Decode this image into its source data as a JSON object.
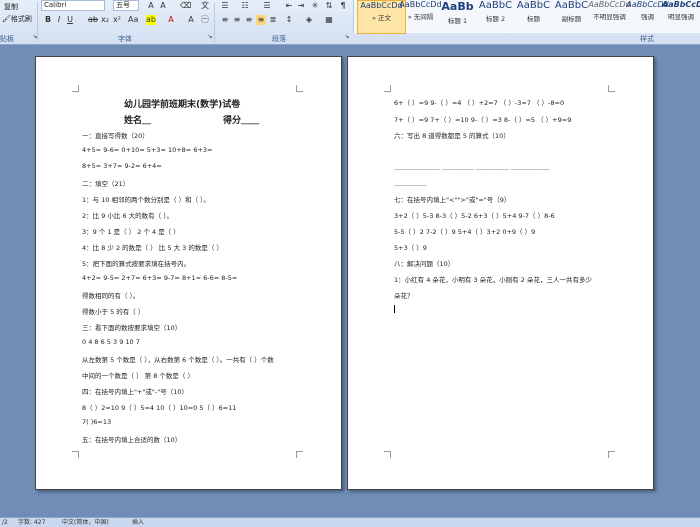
{
  "clipboard": {
    "copy": "复制",
    "format_painter": "格式刷"
  },
  "font": {
    "name": "Calibri",
    "size": "五号"
  },
  "groups": {
    "clipboard": "贴板",
    "font": "字体",
    "paragraph": "段落",
    "styles": "样式"
  },
  "styles": [
    {
      "preview": "AaBbCcDd",
      "name": "» 正文",
      "selected": true
    },
    {
      "preview": "AaBbCcDd",
      "name": "» 无间隔",
      "selected": false
    },
    {
      "preview": "AaBb",
      "name": "标题 1",
      "selected": false
    },
    {
      "preview": "AaBbC",
      "name": "标题 2",
      "selected": false
    },
    {
      "preview": "AaBbC",
      "name": "标题",
      "selected": false
    },
    {
      "preview": "AaBbC",
      "name": "副标题",
      "selected": false
    },
    {
      "preview": "AaBbCcDd",
      "name": "不明显强调",
      "selected": false
    },
    {
      "preview": "AaBbCcDd",
      "name": "强调",
      "selected": false
    },
    {
      "preview": "AaBbCcD",
      "name": "明显强调",
      "selected": false
    }
  ],
  "page1": {
    "title": "幼儿园学前班期末(数学)试卷",
    "name_line": "姓名＿　　　　　　　　得分＿＿",
    "lines": [
      "一：直接写得数（20）",
      "4+5=      9-6=      0+10=    5+3=      10+8=                                          6+3=",
      "8+5=                           3+7=                          9-2=                          6+4=",
      "二：填空（21）",
      "1：与 10 相邻的两个数分别是（ ）和（ ）。",
      "2：比 9 小比 6 大的数有（ ）。",
      "3：9 个 1 是（ ） 2 个 4 是（ ）",
      "4：比 8 少 2 的数是（ ） 比 5 大 3 的数是（ ）",
      "5：把下面的算式按要求填在括号内。",
      "4+2=   9-5=   2+7=   6+3=   9-7=   8+1=   6-6=   8-5=",
      "得数相同的有（ ）。",
      "得数小于 5 的有（ ）",
      "三：看下面的数按要求填空（10）",
      "0    4    8    6    5    3    9    10    7",
      "从左数第 5 个数是（ ），从右数第 6 个数是（ ）。一共有（ ）个数",
      "中间的一个数是（ ） 第 8 个数是（ ）",
      "四：在括号内填上\"+\"或\"-\"号（10）",
      "8（ ）2=10        9（ ）5=4        10（ ）10=0          5（ ）6=11",
      "7(  )6=13",
      "  五：在括号内填上合适的数（10）"
    ]
  },
  "page2": {
    "lines": [
      "6+（ ）=9         9-（ ）=4      （ ）+2=7       （ ）-3=7      （ ）-8=0",
      "7+（ ）=9        7+（ ）=10       9-（ ）=3       8-（ ）=5      （ ）+9=9",
      "六：写出 8 道得数都是 5 的算式（10）",
      "",
      "＿＿＿＿＿＿＿       ＿＿＿＿＿        ＿＿＿＿＿         ＿＿＿＿＿＿",
      "＿＿＿＿＿",
      "七：在括号内填上\"<\"\">\"或\"=\"号（9）",
      "3+2（ ）5-3          8-3（ ）5-2          6+3（ ）5+4          9-7（ ）8-6",
      "5-5（ ）2             7-2（ ）9             5+4（ ）3+2           0+9（ ）9",
      "5+3（ ）9",
      "八：解决问题（10）",
      "1：小红有 4 朵花，小明有 3 朵花，小刚有 2 朵花，三人一共有多少",
      "朵花？"
    ]
  },
  "status": {
    "page": "/2",
    "words": "字数: 427",
    "language": "中文(简体，中国)",
    "mode": "插入"
  }
}
